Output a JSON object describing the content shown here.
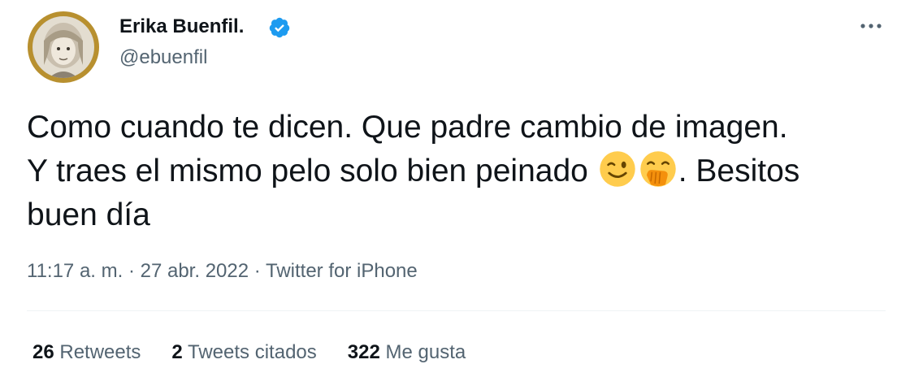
{
  "author": {
    "display_name": "Erika Buenfil.",
    "handle": "@ebuenfil",
    "verified_icon": "verified-badge-icon",
    "avatar_icon": "profile-avatar"
  },
  "more_icon": "more-options-icon",
  "tweet": {
    "line1": "Como cuando te dicen. Que padre cambio de imagen.",
    "line2_before_emoji": "Y traes el mismo pelo solo bien peinado",
    "emojis": [
      "winking-face-emoji",
      "face-with-hand-over-mouth-emoji"
    ],
    "line2_after_emoji": ". Besitos",
    "line3": "buen día"
  },
  "meta": {
    "time": "11:17 a. m.",
    "sep1": " · ",
    "date": "27 abr. 2022",
    "sep2": " · ",
    "source": "Twitter for iPhone"
  },
  "stats": {
    "retweets_count": "26",
    "retweets_label": "Retweets",
    "quotes_count": "2",
    "quotes_label": "Tweets citados",
    "likes_count": "322",
    "likes_label": "Me gusta"
  },
  "colors": {
    "text_primary": "#0f1419",
    "text_secondary": "#536471",
    "verified_blue": "#1d9bf0",
    "divider": "#eff3f4"
  }
}
